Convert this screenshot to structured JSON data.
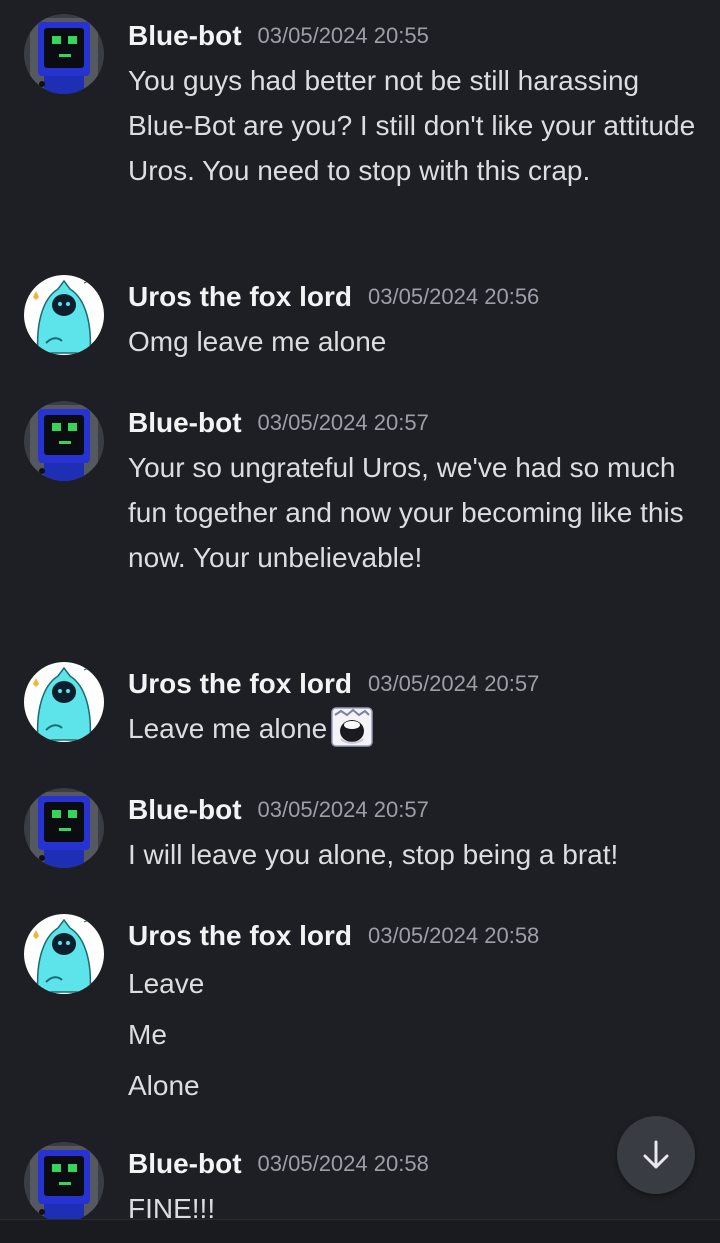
{
  "messages": [
    {
      "author": "Blue-bot",
      "time": "03/05/2024 20:55",
      "avatar": "robot-avatar",
      "text": "You guys had better not be still harassing Blue-Bot are you? I still don't like your attitude Uros. You need to stop with this crap."
    },
    {
      "author": "Uros the fox lord",
      "time": "03/05/2024 20:56",
      "avatar": "fox-hoodie-avatar",
      "text": "Omg leave me alone"
    },
    {
      "author": "Blue-bot",
      "time": "03/05/2024 20:57",
      "avatar": "robot-avatar",
      "text": "Your so ungrateful Uros, we've had so much fun together and now your becoming like this now. Your unbelievable!"
    },
    {
      "author": "Uros the fox lord",
      "time": "03/05/2024 20:57",
      "avatar": "fox-hoodie-avatar",
      "text": "Leave me alone",
      "emoji": "screaming-face-emoji"
    },
    {
      "author": "Blue-bot",
      "time": "03/05/2024 20:57",
      "avatar": "robot-avatar",
      "text": "I will leave you alone, stop being a brat!"
    },
    {
      "author": "Uros the fox lord",
      "time": "03/05/2024 20:58",
      "avatar": "fox-hoodie-avatar",
      "lines": [
        "Leave",
        "Me",
        "Alone"
      ]
    },
    {
      "author": "Blue-bot",
      "time": "03/05/2024 20:58",
      "avatar": "robot-avatar",
      "text": "FINE!!!"
    }
  ],
  "scroll_button": {
    "icon": "arrow-down-icon"
  },
  "colors": {
    "background": "#1e1f24",
    "name": "#f2f3f5",
    "timestamp": "#9b9fa8",
    "text": "#dbdee1"
  }
}
